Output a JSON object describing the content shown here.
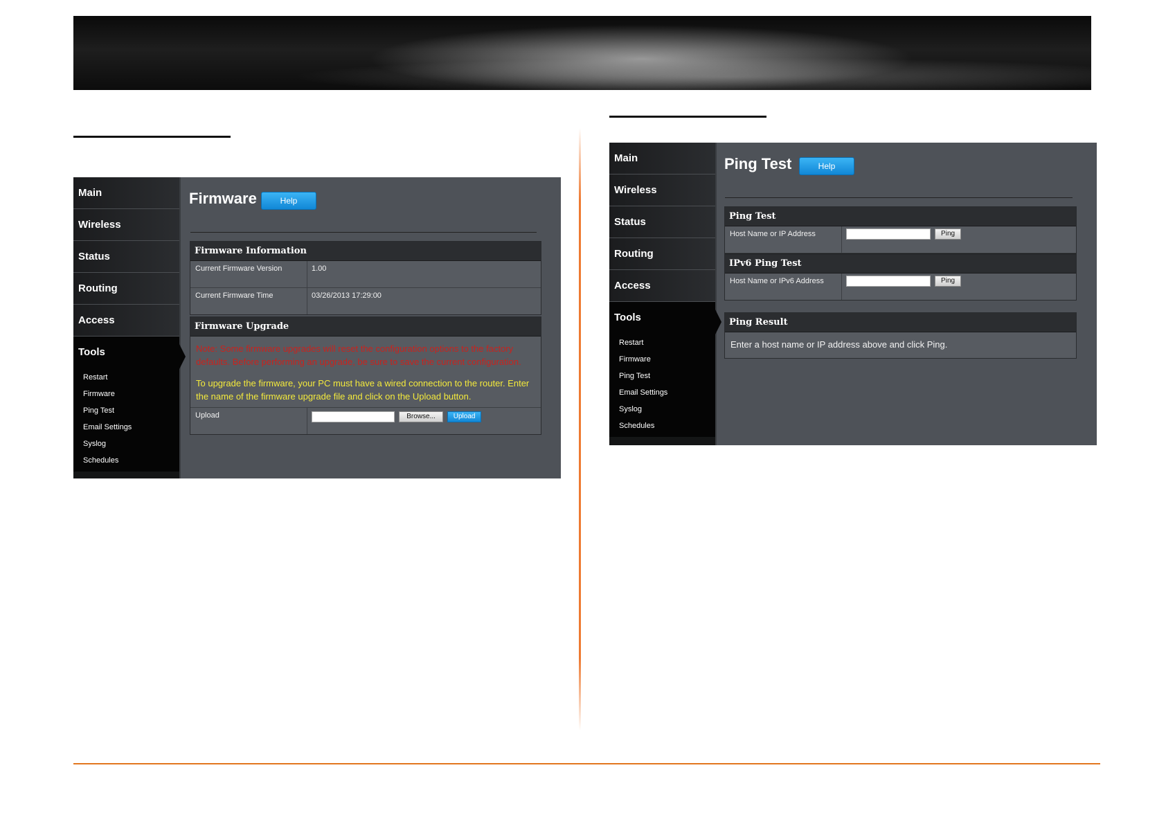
{
  "left": {
    "nav": [
      "Main",
      "Wireless",
      "Status",
      "Routing",
      "Access"
    ],
    "active_nav": "Tools",
    "subnav": [
      "Restart",
      "Firmware",
      "Ping Test",
      "Email Settings",
      "Syslog",
      "Schedules"
    ],
    "title": "Firmware",
    "help_label": "Help",
    "info_section": {
      "title": "Firmware Information",
      "rows": [
        {
          "label": "Current Firmware Version",
          "value": "1.00"
        },
        {
          "label": "Current Firmware Time",
          "value": "03/26/2013 17:29:00"
        }
      ]
    },
    "upgrade_section": {
      "title": "Firmware Upgrade",
      "note_red": "Note: Some firmware upgrades will reset the configuration options to the factory defaults. Before performing an upgrade, be sure to save the current configuration.",
      "note_yellow": "To upgrade the firmware, your PC must have a wired connection to the router. Enter the name of the firmware upgrade file and click on the Upload button.",
      "upload_label": "Upload",
      "browse_label": "Browse...",
      "upload_button": "Upload",
      "file_value": ""
    }
  },
  "right": {
    "nav": [
      "Main",
      "Wireless",
      "Status",
      "Routing",
      "Access"
    ],
    "active_nav": "Tools",
    "subnav": [
      "Restart",
      "Firmware",
      "Ping Test",
      "Email Settings",
      "Syslog",
      "Schedules"
    ],
    "title": "Ping Test",
    "help_label": "Help",
    "ping_section": {
      "title": "Ping Test",
      "label": "Host Name or IP Address",
      "button": "Ping",
      "value": ""
    },
    "ipv6_section": {
      "title": "IPv6 Ping Test",
      "label": "Host Name or IPv6 Address",
      "button": "Ping",
      "value": ""
    },
    "result_section": {
      "title": "Ping Result",
      "text": "Enter a host name or IP address above and click Ping."
    }
  },
  "colors": {
    "accent_orange": "#e2761f",
    "help_blue": "#1a9be6",
    "note_red": "#c8231e",
    "note_yellow": "#f4ea3c"
  }
}
